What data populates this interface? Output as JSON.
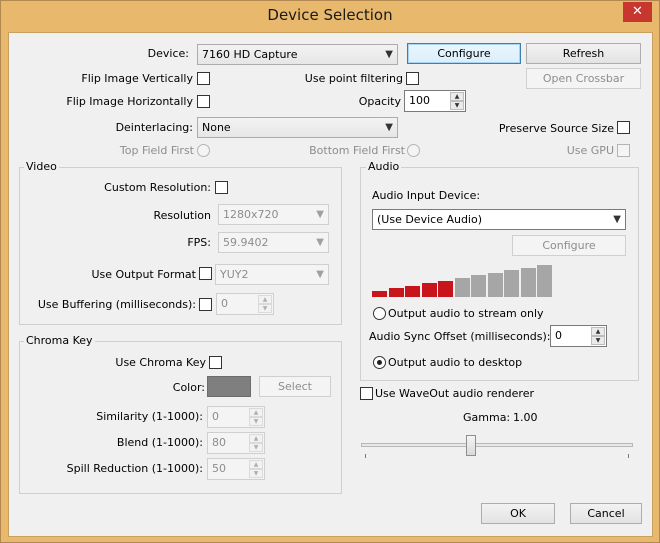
{
  "window": {
    "title": "Device Selection",
    "close_glyph": "✕"
  },
  "top": {
    "device_label": "Device:",
    "device_value": "7160 HD Capture",
    "configure_label": "Configure",
    "refresh_label": "Refresh",
    "open_crossbar_label": "Open Crossbar",
    "flip_vertical_label": "Flip Image Vertically",
    "flip_horizontal_label": "Flip Image Horizontally",
    "point_filtering_label": "Use point filtering",
    "opacity_label": "Opacity",
    "opacity_value": "100",
    "deinterlacing_label": "Deinterlacing:",
    "deinterlacing_value": "None",
    "preserve_size_label": "Preserve Source Size",
    "top_field_first_label": "Top Field First",
    "bottom_field_first_label": "Bottom Field First",
    "use_gpu_label": "Use GPU"
  },
  "video": {
    "title": "Video",
    "custom_resolution_label": "Custom Resolution:",
    "resolution_label": "Resolution",
    "resolution_value": "1280x720",
    "fps_label": "FPS:",
    "fps_value": "59.9402",
    "output_format_label": "Use Output Format",
    "output_format_value": "YUY2",
    "buffering_label": "Use Buffering (milliseconds):",
    "buffering_value": "0"
  },
  "audio": {
    "title": "Audio",
    "input_device_label": "Audio Input Device:",
    "input_device_value": "(Use Device Audio)",
    "configure_label": "Configure",
    "output_stream_only_label": "Output audio to stream only",
    "sync_offset_label": "Audio Sync Offset (milliseconds):",
    "sync_offset_value": "0",
    "output_desktop_label": "Output audio to desktop",
    "meter_active_segments": 5,
    "meter_total_segments": 11,
    "meter_active_color": "#c8151b",
    "meter_inactive_color": "#a6a6a6"
  },
  "chroma": {
    "title": "Chroma Key",
    "use_label": "Use Chroma Key",
    "color_label": "Color:",
    "color_value": "#7f7f7f",
    "select_label": "Select",
    "similarity_label": "Similarity (1-1000):",
    "similarity_value": "0",
    "blend_label": "Blend (1-1000):",
    "blend_value": "80",
    "spill_label": "Spill Reduction (1-1000):",
    "spill_value": "50"
  },
  "waveout": {
    "label": "Use WaveOut audio renderer"
  },
  "gamma": {
    "label": "Gamma:",
    "value": "1.00",
    "slider_fraction": 0.4
  },
  "footer": {
    "ok_label": "OK",
    "cancel_label": "Cancel"
  },
  "icons": {
    "dropdown": "▼",
    "spin_up": "▲",
    "spin_down": "▼"
  }
}
